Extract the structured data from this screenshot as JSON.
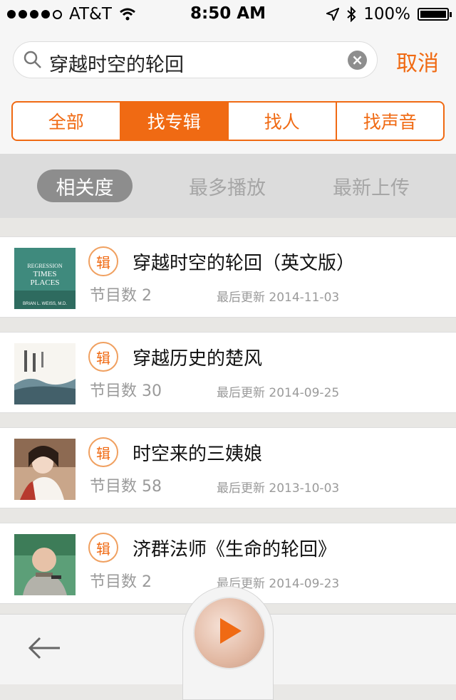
{
  "status_bar": {
    "carrier": "AT&T",
    "time": "8:50 AM",
    "battery": "100%"
  },
  "search": {
    "query": "穿越时空的轮回",
    "cancel_label": "取消"
  },
  "tabs": [
    {
      "label": "全部",
      "active": false
    },
    {
      "label": "找专辑",
      "active": true
    },
    {
      "label": "找人",
      "active": false
    },
    {
      "label": "找声音",
      "active": false
    }
  ],
  "sort_options": [
    {
      "label": "相关度",
      "active": true
    },
    {
      "label": "最多播放",
      "active": false
    },
    {
      "label": "最新上传",
      "active": false
    }
  ],
  "results": [
    {
      "badge": "辑",
      "title": "穿越时空的轮回（英文版）",
      "count": "节目数 2",
      "updated": "最后更新 2014-11-03",
      "cover_text": [
        "REGRESSION",
        "TIMES",
        "PLACES",
        "BRIAN L. WEISS, M.D."
      ]
    },
    {
      "badge": "辑",
      "title": "穿越历史的楚风",
      "count": "节目数 30",
      "updated": "最后更新 2014-09-25"
    },
    {
      "badge": "辑",
      "title": "时空来的三姨娘",
      "count": "节目数 58",
      "updated": "最后更新 2013-10-03"
    },
    {
      "badge": "辑",
      "title": "济群法师《生命的轮回》",
      "count": "节目数 2",
      "updated": "最后更新 2014-09-23"
    }
  ],
  "colors": {
    "accent": "#f06a13",
    "sort_active": "#8d8d8d"
  },
  "icons": {
    "back": "back-arrow-icon",
    "player": "play-icon",
    "search": "search-icon",
    "clear": "clear-icon"
  }
}
